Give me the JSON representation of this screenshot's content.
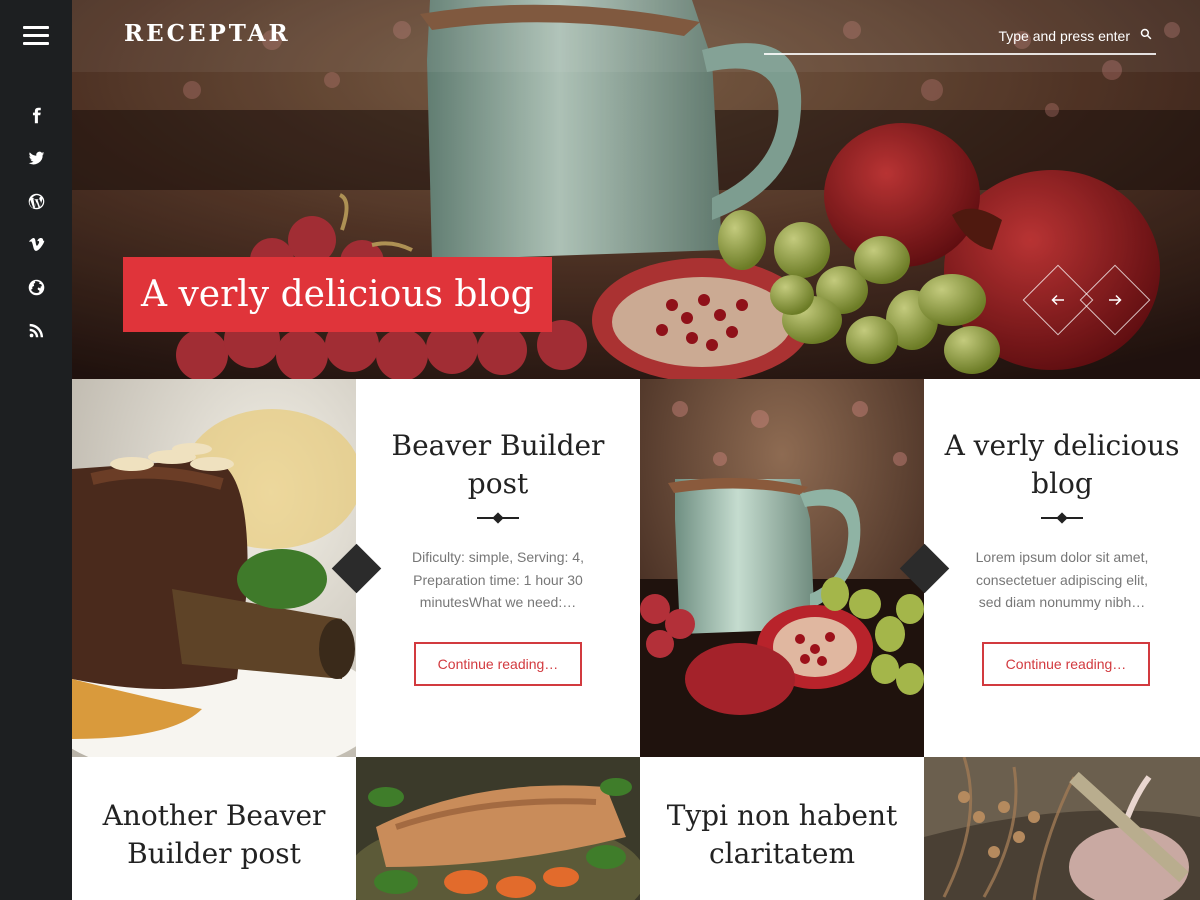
{
  "site": {
    "logo": "RECEPTAR"
  },
  "search": {
    "placeholder": "Type and press enter"
  },
  "sidebar": {
    "social": [
      "facebook-icon",
      "twitter-icon",
      "wordpress-icon",
      "vimeo-icon",
      "globe-icon",
      "rss-icon"
    ]
  },
  "hero": {
    "title": "A verly delicious blog"
  },
  "posts": [
    {
      "title": "Beaver Builder post",
      "excerpt": "Dificulty: simple, Serving: 4, Preparation time: 1 hour 30 minutesWhat we need:…",
      "button": "Continue reading…"
    },
    {
      "title": "A verly delicious blog",
      "excerpt": "Lorem ipsum dolor sit amet, consectetuer adipiscing elit, sed diam nonummy nibh…",
      "button": "Continue reading…"
    },
    {
      "title": "Another Beaver Builder post"
    },
    {
      "title": "Typi non habent claritatem"
    }
  ],
  "colors": {
    "accent": "#e0343a",
    "sidebar": "#1d1f21"
  }
}
